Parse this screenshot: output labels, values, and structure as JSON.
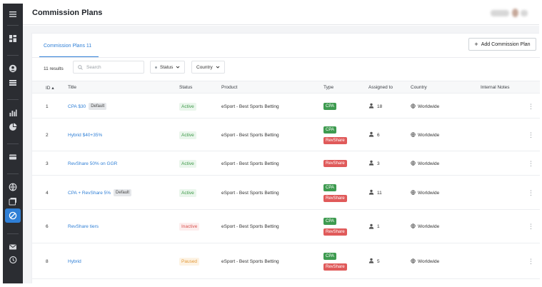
{
  "header": {
    "title": "Commission Plans"
  },
  "tabs": [
    {
      "label": "Commission Plans",
      "count": "11"
    }
  ],
  "toolbar": {
    "add_label": "Add Commission Plan",
    "results": "11 results",
    "search_placeholder": "Search",
    "status_filter": "Status",
    "country_filter": "Country"
  },
  "table": {
    "columns": [
      "ID",
      "Title",
      "Status",
      "Product",
      "Type",
      "Assigned to",
      "Country",
      "Internal Notes"
    ],
    "rows": [
      {
        "id": "1",
        "title": "CPA $30",
        "default": "Default",
        "status": "Active",
        "product": "eSport - Best Sports Betting",
        "types": [
          "CPA"
        ],
        "assigned": "18",
        "country": "Worldwide"
      },
      {
        "id": "2",
        "title": "Hybrid $40+35%",
        "default": "",
        "status": "Active",
        "product": "eSport - Best Sports Betting",
        "types": [
          "CPA",
          "RevShare"
        ],
        "assigned": "6",
        "country": "Worldwide"
      },
      {
        "id": "3",
        "title": "RevShare 50% on GGR",
        "default": "",
        "status": "Active",
        "product": "eSport - Best Sports Betting",
        "types": [
          "RevShare"
        ],
        "assigned": "3",
        "country": "Worldwide"
      },
      {
        "id": "4",
        "title": "CPA + RevShare 5%",
        "default": "Default",
        "status": "Active",
        "product": "eSport - Best Sports Betting",
        "types": [
          "CPA",
          "RevShare"
        ],
        "assigned": "11",
        "country": "Worldwide"
      },
      {
        "id": "6",
        "title": "RevShare tiers",
        "default": "",
        "status": "Inactive",
        "product": "eSport - Best Sports Betting",
        "types": [
          "CPA",
          "RevShare"
        ],
        "assigned": "1",
        "country": "Worldwide"
      },
      {
        "id": "8",
        "title": "Hybrid",
        "default": "",
        "status": "Paused",
        "product": "eSport - Best Sports Betting",
        "types": [
          "CPA",
          "RevShare"
        ],
        "assigned": "5",
        "country": "Worldwide"
      }
    ]
  },
  "colors": {
    "accent": "#2f7fd6",
    "sidebar": "#2b2d32",
    "cpa": "#3e9b50",
    "revshare": "#e05a5a",
    "active": "#3f9a4a",
    "inactive": "#d9534f",
    "paused": "#e39a3b"
  },
  "sidebar_icons": [
    "menu-icon",
    "dashboard-icon",
    "user-icon",
    "list-icon",
    "chart-icon",
    "pie-icon",
    "card-icon",
    "globe-icon",
    "media-icon",
    "commission-icon",
    "mail-icon",
    "history-icon"
  ]
}
